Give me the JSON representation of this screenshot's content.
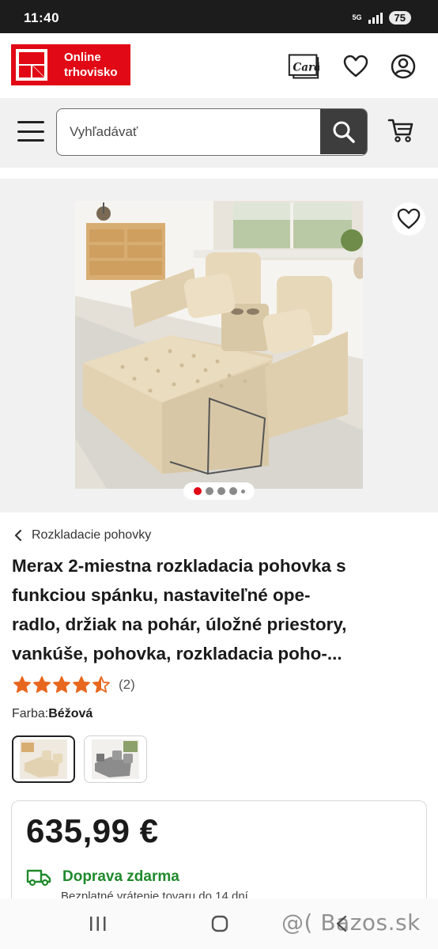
{
  "status_bar": {
    "time": "11:40",
    "network": "5G",
    "battery": "75"
  },
  "header": {
    "logo_text_line1": "Online",
    "logo_text_line2": "trhovisko",
    "card_label": "Card"
  },
  "search": {
    "placeholder": "Vyhľadávať"
  },
  "gallery": {
    "image_count": 5,
    "active_index": 0
  },
  "breadcrumb": {
    "label": "Rozkladacie pohovky"
  },
  "product": {
    "title_lines": [
      "Merax 2-miestna rozkladacia pohovka s",
      "funkciou spánku, nastaviteľné ope-",
      "radlo, držiak na pohár, úložné priestory,",
      "vankúše, pohovka, rozkladacia poho-..."
    ],
    "rating": 4.5,
    "rating_count": "(2)",
    "color_label": "Farba:",
    "color_value": "Béžová",
    "swatches": [
      "beige",
      "gray"
    ]
  },
  "price_box": {
    "price": "635,99 €",
    "delivery_label": "Doprava zdarma",
    "returns_text": "Bezplatné vrátenie tovaru do 14 dní"
  },
  "watermark": "@( Bazos.sk",
  "colors": {
    "brand_red": "#e10915",
    "star_orange": "#e8671f",
    "delivery_green": "#1f8a2b",
    "dark": "#3d3d3d"
  }
}
